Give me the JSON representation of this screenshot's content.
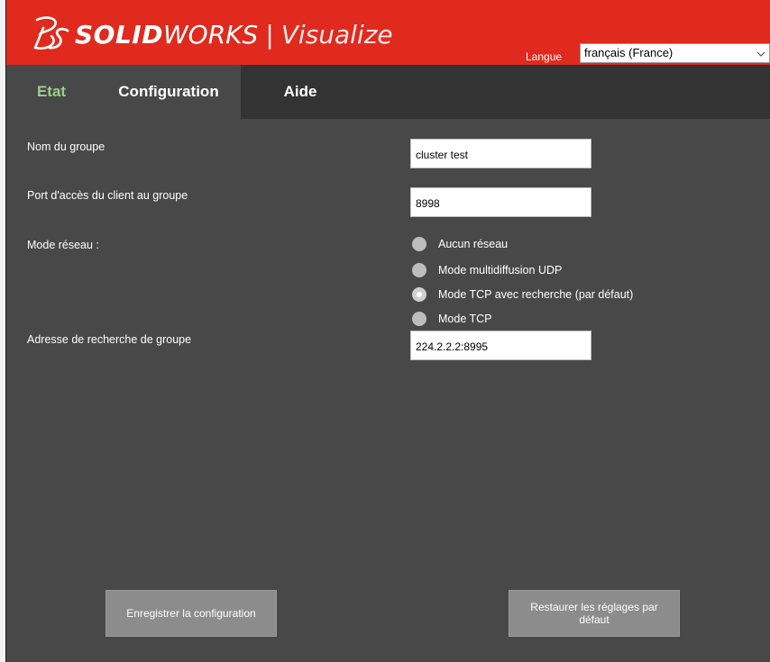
{
  "header": {
    "brand_strong": "SOLID",
    "brand_light": "WORKS",
    "brand_separator": "|",
    "brand_product": "Visualize",
    "language_label": "Langue",
    "language_value": "français (France)",
    "accent_color": "#e02a1e"
  },
  "tabs": [
    {
      "label": "Etat",
      "color": "#9ccf8c"
    },
    {
      "label": "Configuration",
      "active": true
    },
    {
      "label": "Aide"
    }
  ],
  "form": {
    "group_name_label": "Nom du groupe",
    "group_name_value": "cluster test",
    "client_port_label": "Port d'accès du client au groupe",
    "client_port_value": "8998",
    "network_mode_label": "Mode réseau :",
    "network_modes": [
      {
        "label": "Aucun réseau",
        "selected": false
      },
      {
        "label": "Mode multidiffusion UDP",
        "selected": false
      },
      {
        "label": "Mode TCP avec recherche (par défaut)",
        "selected": true
      },
      {
        "label": "Mode TCP",
        "selected": false
      }
    ],
    "discovery_address_label": "Adresse de recherche de groupe",
    "discovery_address_value": "224.2.2.2:8995"
  },
  "buttons": {
    "save_label": "Enregistrer la configuration",
    "restore_label": "Restaurer les réglages par défaut"
  }
}
